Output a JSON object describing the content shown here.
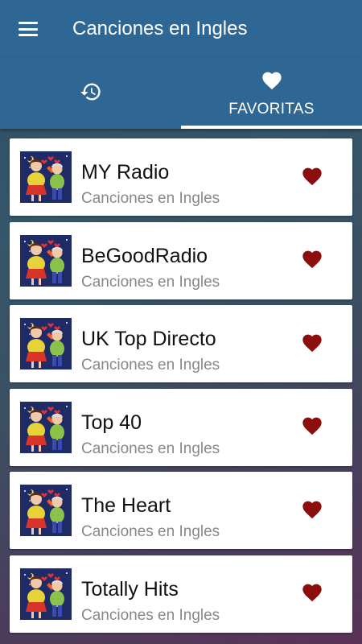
{
  "appbar": {
    "title": "Canciones en Ingles",
    "menu_icon": "hamburger-menu-icon"
  },
  "tabs": [
    {
      "icon": "history-icon",
      "label": "",
      "active": false
    },
    {
      "icon": "heart-icon",
      "label": "FAVORITAS",
      "active": true
    }
  ],
  "stations": [
    {
      "name": "MY Radio",
      "subtitle": "Canciones en Ingles",
      "favorite": true
    },
    {
      "name": "BeGoodRadio",
      "subtitle": "Canciones en Ingles",
      "favorite": true
    },
    {
      "name": "UK Top Directo",
      "subtitle": "Canciones en Ingles",
      "favorite": true
    },
    {
      "name": "Top 40",
      "subtitle": "Canciones en Ingles",
      "favorite": true
    },
    {
      "name": "The Heart",
      "subtitle": "Canciones en Ingles",
      "favorite": true
    },
    {
      "name": "Totally Hits",
      "subtitle": "Canciones en Ingles",
      "favorite": true
    }
  ],
  "colors": {
    "appbar": "#2f6794",
    "favorite_heart": "#8b0d0d"
  }
}
